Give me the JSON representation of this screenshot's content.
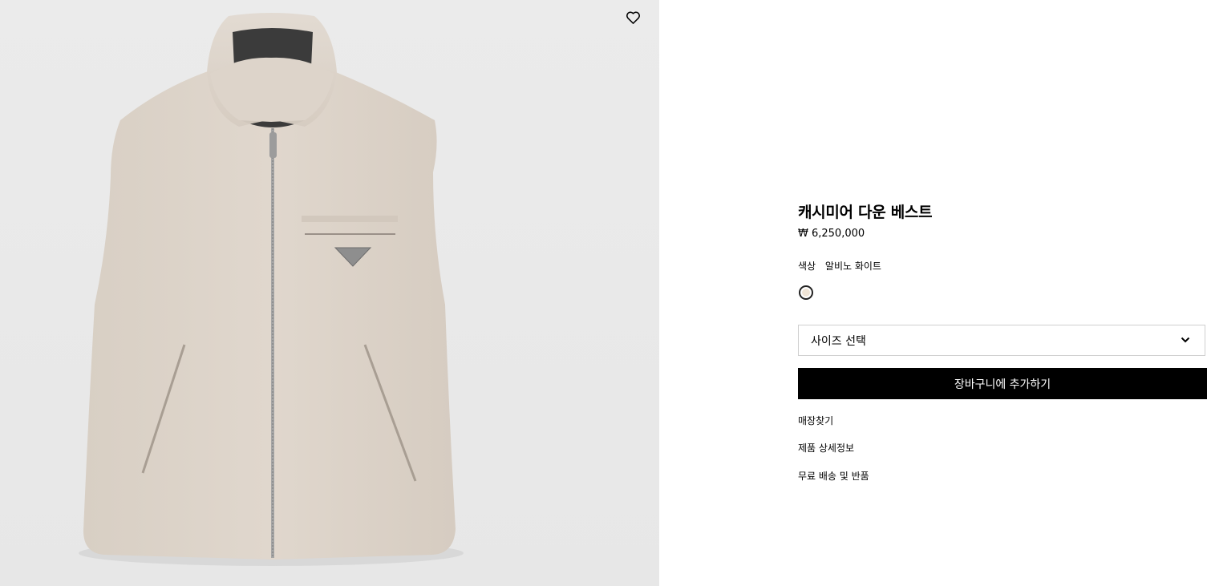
{
  "product": {
    "title": "캐시미어 다운 베스트",
    "price": "₩ 6,250,000",
    "color_label": "색상",
    "color_value": "알비노 화이트",
    "swatch_color": "#efe4d6",
    "size_placeholder": "사이즈 선택",
    "add_to_cart": "장바구니에 추가하기",
    "links": [
      "매장찾기",
      "제품 상세정보",
      "무료 배송 및 반품"
    ]
  },
  "image": {
    "background": "#e9e9e9",
    "garment_color": "#ddd3c8",
    "icons": [
      "heart-icon",
      "chevron-down-icon"
    ]
  }
}
